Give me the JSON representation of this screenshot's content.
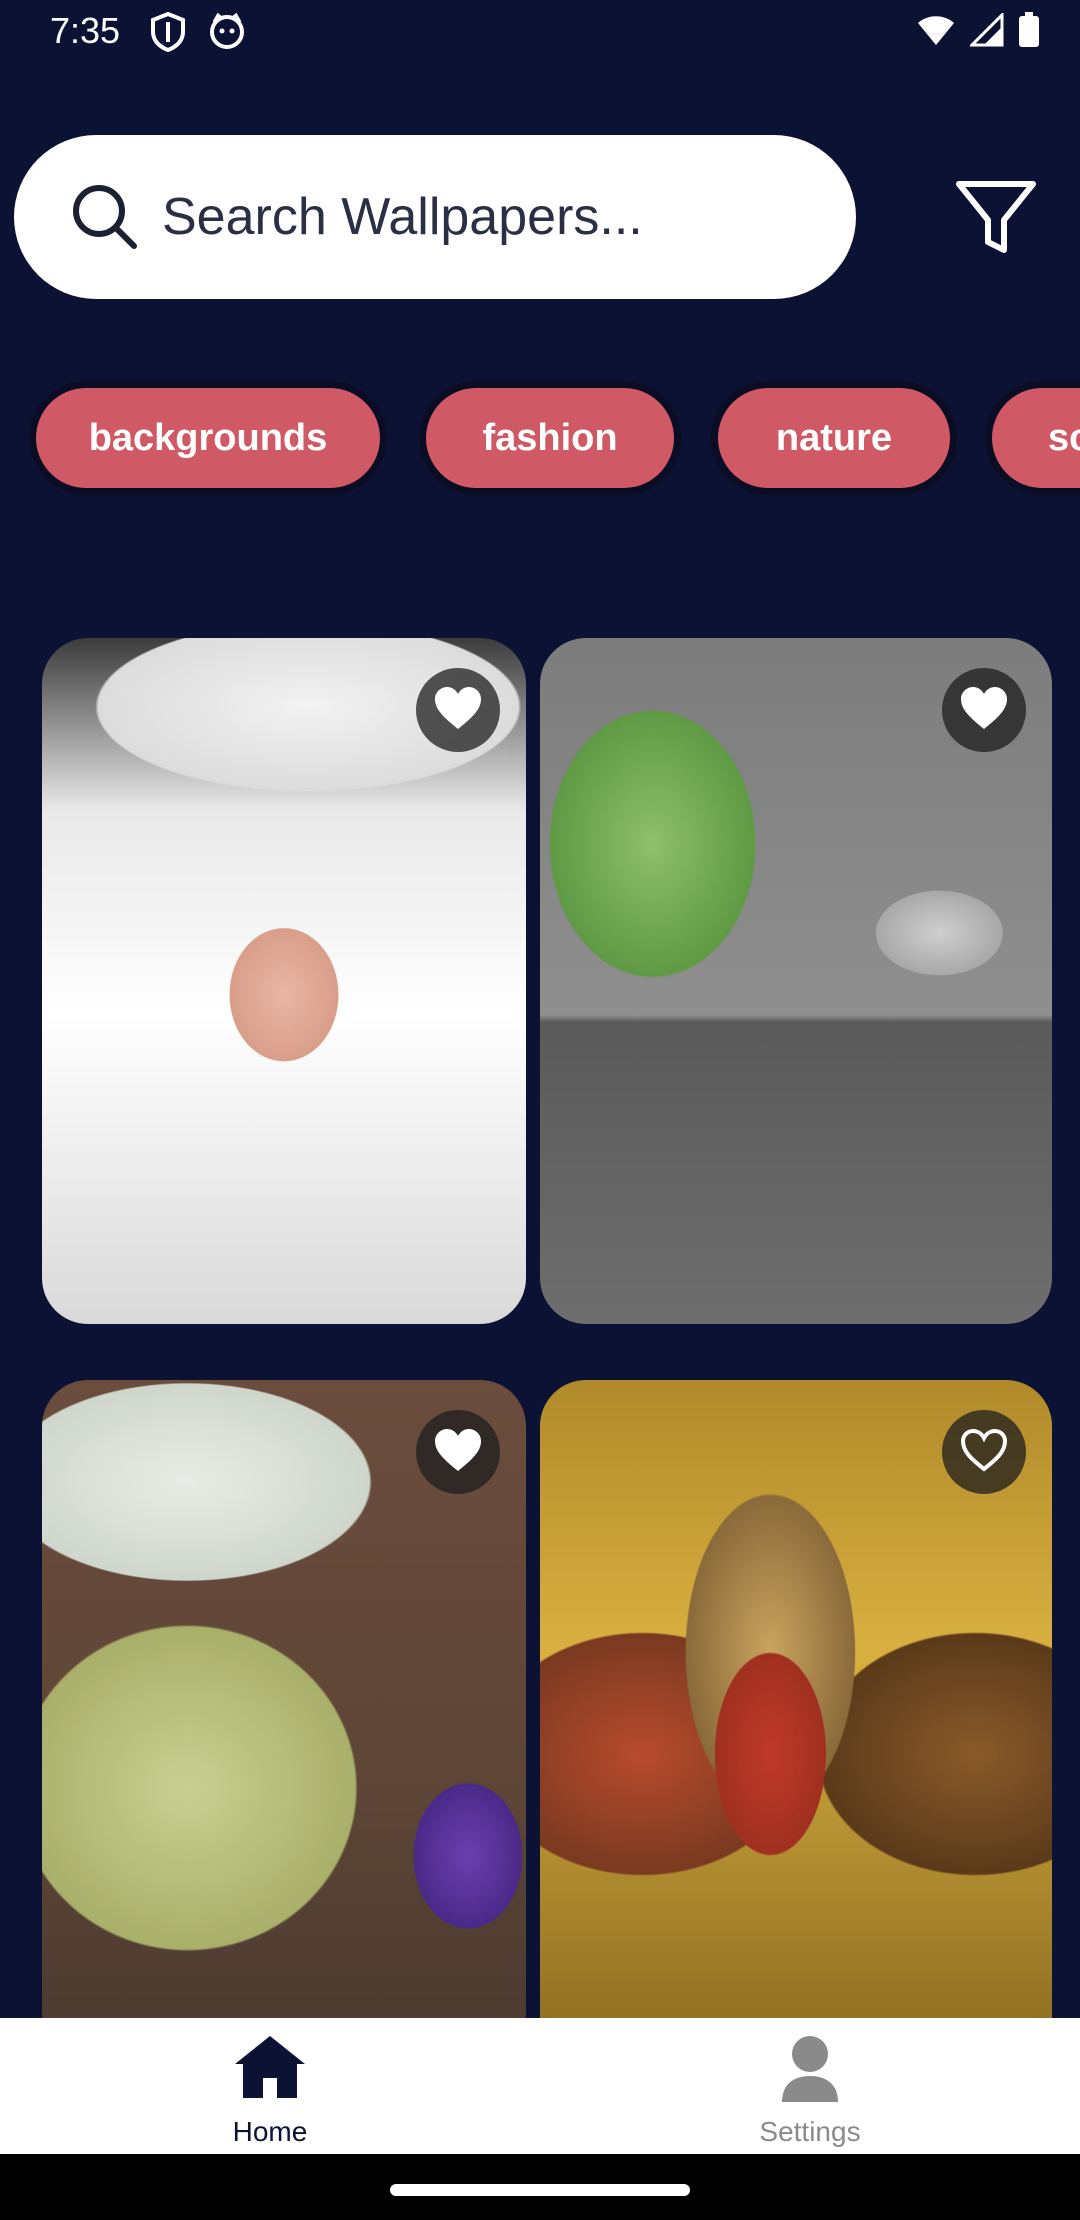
{
  "status_bar": {
    "time": "7:35",
    "left_icons": [
      "shield-icon",
      "cat-face-icon"
    ],
    "right_icons": [
      "wifi-icon",
      "cell-signal-icon",
      "battery-icon"
    ]
  },
  "search": {
    "placeholder": "Search Wallpapers...",
    "icon": "search-icon",
    "filter_icon": "filter-icon"
  },
  "categories": [
    "backgrounds",
    "fashion",
    "nature",
    "sc"
  ],
  "wallpapers": [
    {
      "subject": "woman-in-white-hat",
      "favorited": true
    },
    {
      "subject": "bird-on-stump",
      "favorited": true
    },
    {
      "subject": "butterfly-on-lavender",
      "favorited": true
    },
    {
      "subject": "colorful-hawk",
      "favorited": false
    }
  ],
  "bottom_nav": {
    "items": [
      {
        "label": "Home",
        "icon": "home-icon",
        "active": true
      },
      {
        "label": "Settings",
        "icon": "person-icon",
        "active": false
      }
    ]
  },
  "colors": {
    "background": "#0c1234",
    "chip": "#cf5964",
    "nav_active": "#0c1234",
    "nav_inactive": "#8a8a8a"
  }
}
